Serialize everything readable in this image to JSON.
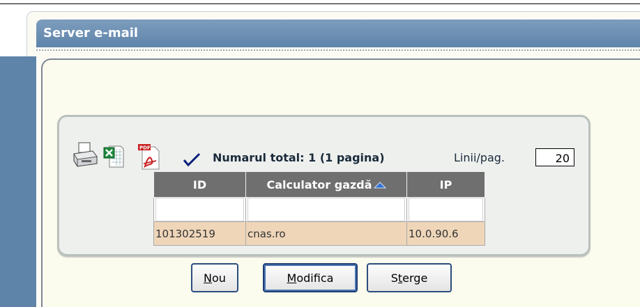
{
  "window": {
    "title": "Server e-mail"
  },
  "toolbar": {
    "icons": [
      "printer-icon",
      "excel-icon",
      "pdf-icon",
      "check-icon"
    ],
    "total_label": "Numarul total: 1 (1 pagina)",
    "lines_label": "Linii/pag.",
    "lines_value": "20"
  },
  "table": {
    "columns": [
      "ID",
      "Calculator gazdă",
      "IP"
    ],
    "sorted_column": "Calculator gazdă",
    "sort_direction": "ascending",
    "rows": [
      [
        "101302519",
        "cnas.ro",
        "10.0.90.6"
      ]
    ]
  },
  "buttons": {
    "new": {
      "label": "Nou",
      "access_key": "N",
      "rest": "ou"
    },
    "modify": {
      "label": "Modifica",
      "access_key": "M",
      "rest": "odifica"
    },
    "delete": {
      "label": "Sterge",
      "prefix": "S",
      "access_key": "t",
      "rest": "erge"
    }
  },
  "colors": {
    "title_bar": "#6d8fb3",
    "header_bg": "#6f6f6f",
    "row_highlight": "#efd6b9",
    "panel_bg": "#eef0ee"
  }
}
